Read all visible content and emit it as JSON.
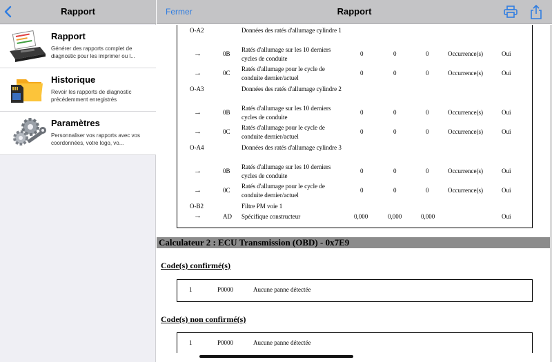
{
  "sidebar": {
    "title": "Rapport",
    "items": [
      {
        "title": "Rapport",
        "desc": "Générer des rapports complet de diagnostic pour les imprimer ou l...",
        "icon": "printer-report-icon"
      },
      {
        "title": "Historique",
        "desc": "Revoir les rapports de diagnostic précédemment enregistrés",
        "icon": "folder-sdcard-icon"
      },
      {
        "title": "Paramètres",
        "desc": "Personnaliser vos rapports avec vos coordonnées, votre logo, vo...",
        "icon": "gears-wrench-icon"
      }
    ]
  },
  "header": {
    "close_label": "Fermer",
    "title": "Rapport",
    "accent": "#2f7de1"
  },
  "table_rows": [
    {
      "code": "O-A2",
      "pid": "",
      "desc": "Données des ratés d'allumage cylindre 1",
      "v1": "",
      "v2": "",
      "v3": "",
      "unit": "",
      "yn": ""
    },
    {
      "code": "→",
      "pid": "0B",
      "desc": "Ratés d'allumage sur les 10 derniers cycles de conduite",
      "v1": "0",
      "v2": "0",
      "v3": "0",
      "unit": "Occurrence(s)",
      "yn": "Oui"
    },
    {
      "code": "→",
      "pid": "0C",
      "desc": "Ratés d'allumage pour le cycle de conduite dernier/actuel",
      "v1": "0",
      "v2": "0",
      "v3": "0",
      "unit": "Occurrence(s)",
      "yn": "Oui"
    },
    {
      "code": "O-A3",
      "pid": "",
      "desc": "Données des ratés d'allumage cylindre 2",
      "v1": "",
      "v2": "",
      "v3": "",
      "unit": "",
      "yn": ""
    },
    {
      "code": "→",
      "pid": "0B",
      "desc": "Ratés d'allumage sur les 10 derniers cycles de conduite",
      "v1": "0",
      "v2": "0",
      "v3": "0",
      "unit": "Occurrence(s)",
      "yn": "Oui"
    },
    {
      "code": "→",
      "pid": "0C",
      "desc": "Ratés d'allumage pour le cycle de conduite dernier/actuel",
      "v1": "0",
      "v2": "0",
      "v3": "0",
      "unit": "Occurrence(s)",
      "yn": "Oui"
    },
    {
      "code": "O-A4",
      "pid": "",
      "desc": "Données des ratés d'allumage cylindre 3",
      "v1": "",
      "v2": "",
      "v3": "",
      "unit": "",
      "yn": ""
    },
    {
      "code": "→",
      "pid": "0B",
      "desc": "Ratés d'allumage sur les 10 derniers cycles de conduite",
      "v1": "0",
      "v2": "0",
      "v3": "0",
      "unit": "Occurrence(s)",
      "yn": "Oui"
    },
    {
      "code": "→",
      "pid": "0C",
      "desc": "Ratés d'allumage pour le cycle de conduite dernier/actuel",
      "v1": "0",
      "v2": "0",
      "v3": "0",
      "unit": "Occurrence(s)",
      "yn": "Oui"
    },
    {
      "code": "O-B2",
      "pid": "",
      "desc": "Filtre PM voie 1",
      "v1": "",
      "v2": "",
      "v3": "",
      "unit": "",
      "yn": ""
    },
    {
      "code": "→",
      "pid": "AD",
      "desc": "Spécifique constructeur",
      "v1": "0,000",
      "v2": "0,000",
      "v3": "0,000",
      "unit": "",
      "yn": "Oui"
    }
  ],
  "ecu": {
    "title": "Calculateur 2 : ECU Transmission (OBD) - 0x7E9"
  },
  "confirmed": {
    "title": "Code(s) confirmé(s)",
    "rows": [
      {
        "num": "1",
        "code": "P0000",
        "desc": "Aucune panne détectée"
      }
    ]
  },
  "unconfirmed": {
    "title": "Code(s) non confirmé(s)",
    "rows": [
      {
        "num": "1",
        "code": "P0000",
        "desc": "Aucune panne détectée"
      }
    ]
  }
}
